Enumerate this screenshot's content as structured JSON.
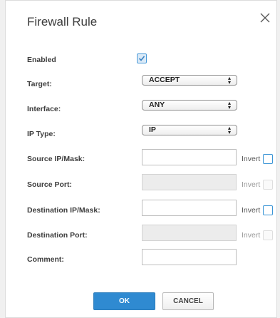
{
  "dialog": {
    "title": "Firewall Rule"
  },
  "icons": {
    "close": "close-icon",
    "checkmark": "checkmark-icon",
    "select_arrows": "updown-arrows-icon"
  },
  "fields": {
    "enabled": {
      "label": "Enabled",
      "checked": true
    },
    "target": {
      "label": "Target:",
      "value": "ACCEPT"
    },
    "interface": {
      "label": "Interface:",
      "value": "ANY"
    },
    "ip_type": {
      "label": "IP Type:",
      "value": "IP"
    },
    "source_ip": {
      "label": "Source IP/Mask:",
      "value": "",
      "invert_label": "Invert",
      "invert_checked": false
    },
    "source_port": {
      "label": "Source Port:",
      "value": "",
      "disabled": true,
      "invert_label": "Invert",
      "invert_checked": false
    },
    "dest_ip": {
      "label": "Destination IP/Mask:",
      "value": "",
      "invert_label": "Invert",
      "invert_checked": false
    },
    "dest_port": {
      "label": "Destination Port:",
      "value": "",
      "disabled": true,
      "invert_label": "Invert",
      "invert_checked": false
    },
    "comment": {
      "label": "Comment:",
      "value": ""
    }
  },
  "buttons": {
    "ok": "OK",
    "cancel": "CANCEL"
  },
  "colors": {
    "accent": "#2f8ad1",
    "checkbox_border": "#3b95d6"
  }
}
